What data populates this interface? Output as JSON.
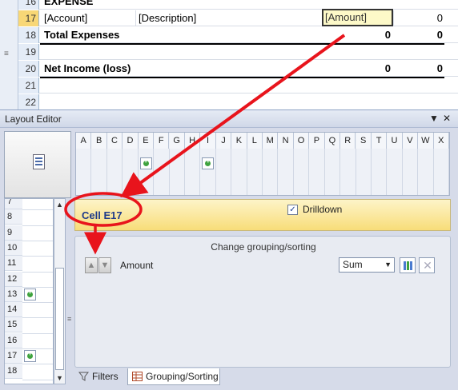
{
  "sheet": {
    "rows": [
      {
        "num": "16",
        "a": "EXPENSE",
        "c": "",
        "e": "",
        "f": "",
        "g": ""
      },
      {
        "num": "17",
        "a": "[Account]",
        "c": "[Description]",
        "e": "[Amount]",
        "f": "",
        "g": "0"
      },
      {
        "num": "18",
        "a": "Total Expenses",
        "c": "",
        "e": "",
        "f": "0",
        "g": "0"
      },
      {
        "num": "19",
        "a": "",
        "c": "",
        "e": "",
        "f": "",
        "g": ""
      },
      {
        "num": "20",
        "a": "Net Income (loss)",
        "c": "",
        "e": "",
        "f": "0",
        "g": "0"
      },
      {
        "num": "21",
        "a": "",
        "c": "",
        "e": "",
        "f": "",
        "g": ""
      },
      {
        "num": "22",
        "a": "",
        "c": "",
        "e": "",
        "f": "",
        "g": ""
      }
    ]
  },
  "editor": {
    "title": "Layout Editor",
    "pin_glyph": "▼",
    "close_glyph": "✕",
    "columns": [
      "A",
      "B",
      "C",
      "D",
      "E",
      "F",
      "G",
      "H",
      "I",
      "J",
      "K",
      "L",
      "M",
      "N",
      "O",
      "P",
      "Q",
      "R",
      "S",
      "T",
      "U",
      "V",
      "W",
      "X"
    ],
    "row_numbers": [
      "7",
      "8",
      "9",
      "10",
      "11",
      "12",
      "13",
      "14",
      "15",
      "16",
      "17",
      "18"
    ],
    "cell_label": "Cell E17",
    "drilldown_label": "Drilldown",
    "drilldown_checked": "✓",
    "group_title": "Change grouping/sorting",
    "group_field": "Amount",
    "aggregate": "Sum",
    "tabs": [
      "Filters",
      "Grouping/Sorting"
    ]
  },
  "colors": {
    "annotation": "#e8141c",
    "selected_cell_fill": "#fdf9c8",
    "cell_band": "#f8dd79"
  }
}
